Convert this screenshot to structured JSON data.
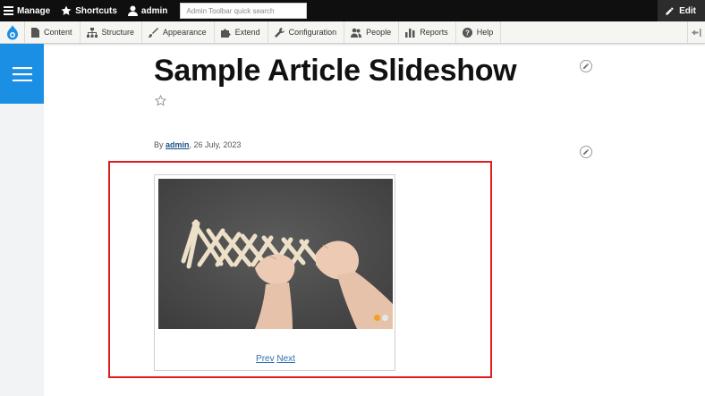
{
  "toolbar": {
    "manage_label": "Manage",
    "shortcuts_label": "Shortcuts",
    "user_label": "admin",
    "search_placeholder": "Admin Toolbar quick search",
    "edit_label": "Edit"
  },
  "tray": {
    "items": [
      {
        "label": "Content",
        "icon": "file-icon"
      },
      {
        "label": "Structure",
        "icon": "sitemap-icon"
      },
      {
        "label": "Appearance",
        "icon": "paintbrush-icon"
      },
      {
        "label": "Extend",
        "icon": "puzzle-icon"
      },
      {
        "label": "Configuration",
        "icon": "wrench-icon"
      },
      {
        "label": "People",
        "icon": "people-icon"
      },
      {
        "label": "Reports",
        "icon": "bar-chart-icon"
      },
      {
        "label": "Help",
        "icon": "help-icon"
      }
    ]
  },
  "article": {
    "title": "Sample Article Slideshow",
    "by_label": "By",
    "author": "admin",
    "date": ", 26 July, 2023"
  },
  "slideshow": {
    "prev_label": "Prev",
    "next_label": "Next",
    "slide_count": 2,
    "active_slide": 1
  },
  "colors": {
    "accent": "#1a8fe3",
    "highlight_border": "#e01c1c",
    "active_dot": "#f0a223",
    "link": "#2f6fb0"
  }
}
